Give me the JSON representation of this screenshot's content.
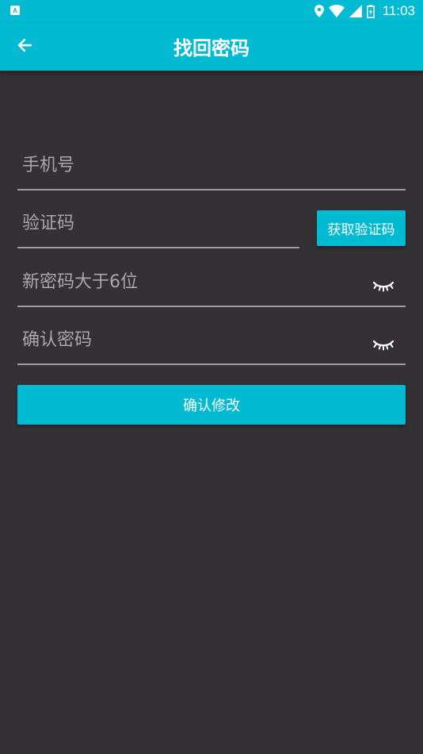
{
  "status_bar": {
    "app_icon_letter": "A",
    "icons": [
      "location-icon",
      "wifi-icon",
      "signal-icon",
      "battery-icon"
    ],
    "time": "11:03"
  },
  "app_bar": {
    "back_icon": "arrow-left-icon",
    "title": "找回密码"
  },
  "form": {
    "phone": {
      "placeholder": "手机号",
      "value": ""
    },
    "code": {
      "placeholder": "验证码",
      "value": ""
    },
    "get_code_button": "获取验证码",
    "new_password": {
      "placeholder": "新密码大于6位",
      "value": "",
      "toggle_icon": "eye-closed-icon"
    },
    "confirm_password": {
      "placeholder": "确认密码",
      "value": "",
      "toggle_icon": "eye-closed-icon"
    },
    "submit_button": "确认修改"
  },
  "colors": {
    "accent": "#03bad3",
    "background": "#333134",
    "underline": "#9e9c9f",
    "placeholder": "#a9a7aa"
  }
}
